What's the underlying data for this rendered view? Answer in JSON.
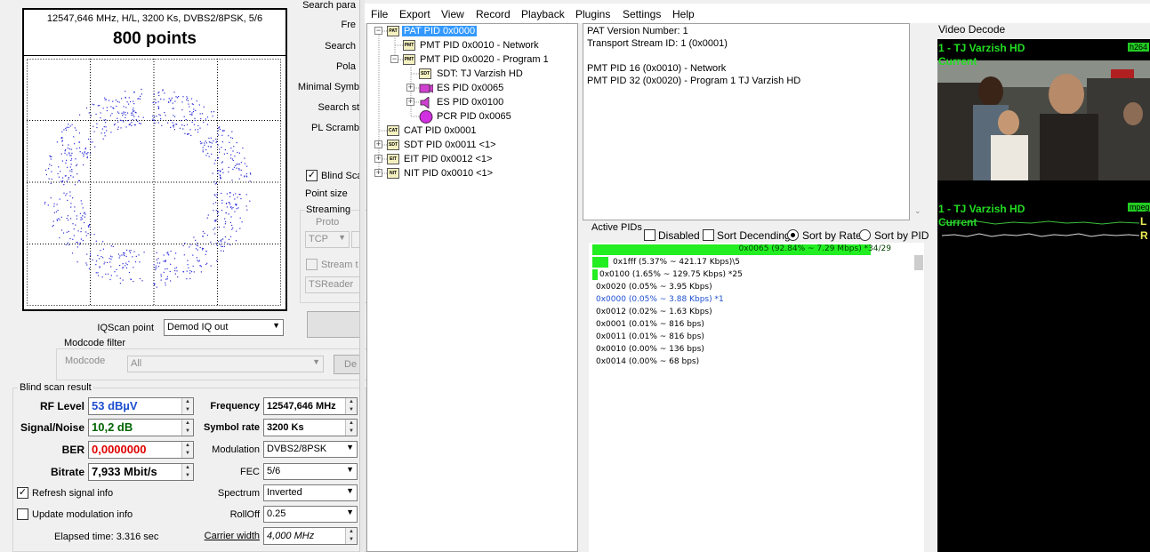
{
  "left_panel": {
    "iq": {
      "info": "12547,646 MHz, H/L, 3200 Ks, DVBS2/8PSK, 5/6",
      "points": "800 points"
    },
    "scan_params_fragments": [
      "Search para",
      "Fre",
      "Search",
      "Pola",
      "Minimal Symb",
      "Search st",
      "PL Scramb"
    ],
    "blind_scan_partial": "Blind Sca",
    "point_size_label": "Point size",
    "streaming": {
      "label": "Streaming",
      "proto_label": "Proto",
      "proto_value": "TCP",
      "stream_partial": "Stream t",
      "tsreader": "TSReader"
    },
    "iqscan_label": "IQScan point",
    "iqscan_value": "Demod IQ out",
    "modcode_filter": {
      "label": "Modcode filter",
      "modcode_label": "Modcode",
      "value": "All",
      "button_partial": "De"
    },
    "blind_scan_result_title": "Blind scan result",
    "fields": {
      "rf_level_label": "RF Level",
      "rf_level_value": "53 dBµV",
      "snr_label": "Signal/Noise",
      "snr_value": "10,2 dB",
      "ber_label": "BER",
      "ber_value": "0,0000000",
      "bitrate_label": "Bitrate",
      "bitrate_value": "7,933 Mbit/s",
      "frequency_label": "Frequency",
      "frequency_value": "12547,646 MHz",
      "symbol_rate_label": "Symbol rate",
      "symbol_rate_value": "3200 Ks",
      "modulation_label": "Modulation",
      "modulation_value": "DVBS2/8PSK",
      "fec_label": "FEC",
      "fec_value": "5/6",
      "spectrum_label": "Spectrum",
      "spectrum_value": "Inverted",
      "rolloff_label": "RollOff",
      "rolloff_value": "0.25",
      "carrier_width_label": "Carrier width",
      "carrier_width_value": "4,000 MHz"
    },
    "refresh_label": "Refresh signal info",
    "update_mod_label": "Update modulation info",
    "elapsed": "Elapsed time: 3.316 sec"
  },
  "menu": [
    "File",
    "Export",
    "View",
    "Record",
    "Playback",
    "Plugins",
    "Settings",
    "Help"
  ],
  "tree": {
    "pat": "PAT PID 0x0000",
    "pmt_network": "PMT PID 0x0010 - Network",
    "pmt_program": "PMT PID 0x0020 - Program 1",
    "sdt_sub": "SDT: TJ Varzish HD",
    "es1": "ES PID 0x0065",
    "es2": "ES PID 0x0100",
    "pcr": "PCR PID 0x0065",
    "cat": "CAT PID 0x0001",
    "sdt": "SDT PID 0x0011 <1>",
    "eit": "EIT PID 0x0012 <1>",
    "nit": "NIT PID 0x0010 <1>",
    "icons": {
      "pat": "PAT",
      "pmt": "PMT",
      "sdt": "SDT",
      "cat": "CAT",
      "eit": "EIT",
      "nit": "NIT"
    }
  },
  "info_panel": {
    "lines": [
      "PAT Version Number: 1",
      "Transport Stream ID: 1 (0x0001)",
      "",
      "PMT PID 16 (0x0010) - Network",
      "PMT PID 32 (0x0020) - Program 1 TJ Varzish HD"
    ]
  },
  "active_pids": {
    "title": "Active PIDs",
    "disabled_label": "Disabled",
    "sort_desc_label": "Sort Decending",
    "sort_rate_label": "Sort by Rate",
    "sort_pid_label": "Sort by PID",
    "rows": [
      {
        "text": "0x0065 (92.84% ~ 7.29 Mbps) *34/29",
        "fraction": 0.9284
      },
      {
        "text": "0x1fff (5.37% ~ 421.17 Kbps)\\5",
        "fraction": 0.0537
      },
      {
        "text": "0x0100 (1.65% ~ 129.75 Kbps) *25",
        "fraction": 0.0165
      },
      {
        "text": "0x0020 (0.05% ~ 3.95 Kbps)",
        "fraction": 0
      },
      {
        "text": "0x0000 (0.05% ~ 3.88 Kbps) *1",
        "fraction": 0
      },
      {
        "text": "0x0012 (0.02% ~ 1.63 Kbps)",
        "fraction": 0
      },
      {
        "text": "0x0001 (0.01% ~ 816 bps)",
        "fraction": 0
      },
      {
        "text": "0x0011 (0.01% ~ 816 bps)",
        "fraction": 0
      },
      {
        "text": "0x0010 (0.00% ~ 136 bps)",
        "fraction": 0
      },
      {
        "text": "0x0014 (0.00% ~ 68 bps)",
        "fraction": 0
      }
    ]
  },
  "video": {
    "title": "Video Decode",
    "channel": "1 - TJ Varzish HD",
    "status": "Current",
    "video_codec": "h264",
    "audio_channel": "1 - TJ Varzish HD",
    "audio_status": "Current",
    "audio_codec": "mpeg",
    "audio_l": "L",
    "audio_r": "R"
  },
  "colors": {
    "accent_blue": "#1e4fd0",
    "green_value": "#006400",
    "red_value": "#e00000",
    "pid_bar": "#22ee22",
    "overlay_green": "#22dd22",
    "selection": "#3399ff"
  }
}
